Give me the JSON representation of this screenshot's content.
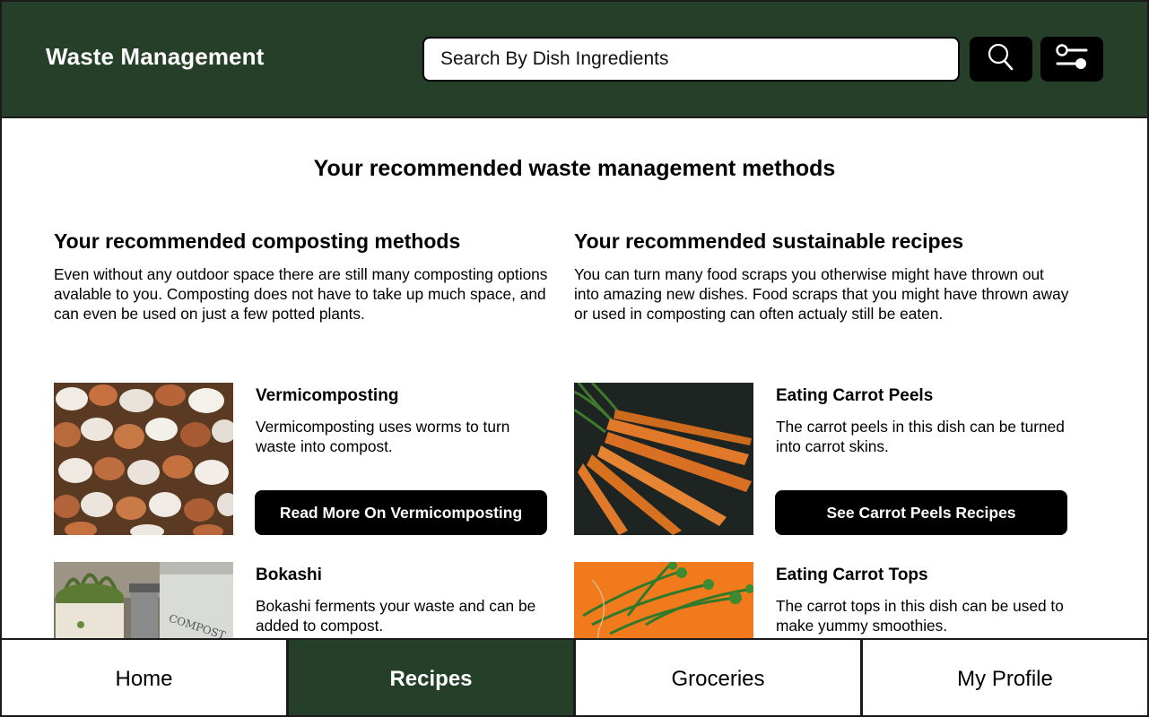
{
  "header": {
    "title": "Waste Management",
    "search_placeholder": "Search By Dish Ingredients",
    "search_icon": "search-icon",
    "filter_icon": "sliders-icon",
    "brand_color": "#263f28"
  },
  "main": {
    "title": "Your recommended waste management methods",
    "composting": {
      "heading": "Your recommended composting methods",
      "intro": "Even without any outdoor space there are still many composting options avalable to you.  Composting does not have to take up much space, and can even be used on just a few potted plants.",
      "cards": [
        {
          "title": "Vermicomposting",
          "description": "Vermicomposting uses worms to turn waste into compost.",
          "button": "Read More On Vermicomposting",
          "image": "eggshells-photo"
        },
        {
          "title": "Bokashi",
          "description": "Bokashi ferments your waste and can be added to compost.",
          "image": "compost-bin-photo"
        }
      ]
    },
    "recipes": {
      "heading": "Your recommended sustainable recipes",
      "intro": "You can turn many food scraps you otherwise might have thrown out into amazing new dishes. Food scraps that you might have thrown away or used in composting can often actualy still be eaten.",
      "cards": [
        {
          "title": "Eating Carrot Peels",
          "description": "The carrot peels in this dish can be turned into carrot skins.",
          "button": "See Carrot Peels Recipes",
          "image": "carrots-photo"
        },
        {
          "title": "Eating Carrot Tops",
          "description": "The carrot tops in this dish can be used to make yummy smoothies.",
          "image": "carrot-tops-photo"
        }
      ]
    }
  },
  "nav": {
    "tabs": [
      {
        "label": "Home"
      },
      {
        "label": "Recipes",
        "active": true
      },
      {
        "label": "Groceries"
      },
      {
        "label": "My Profile"
      }
    ]
  }
}
